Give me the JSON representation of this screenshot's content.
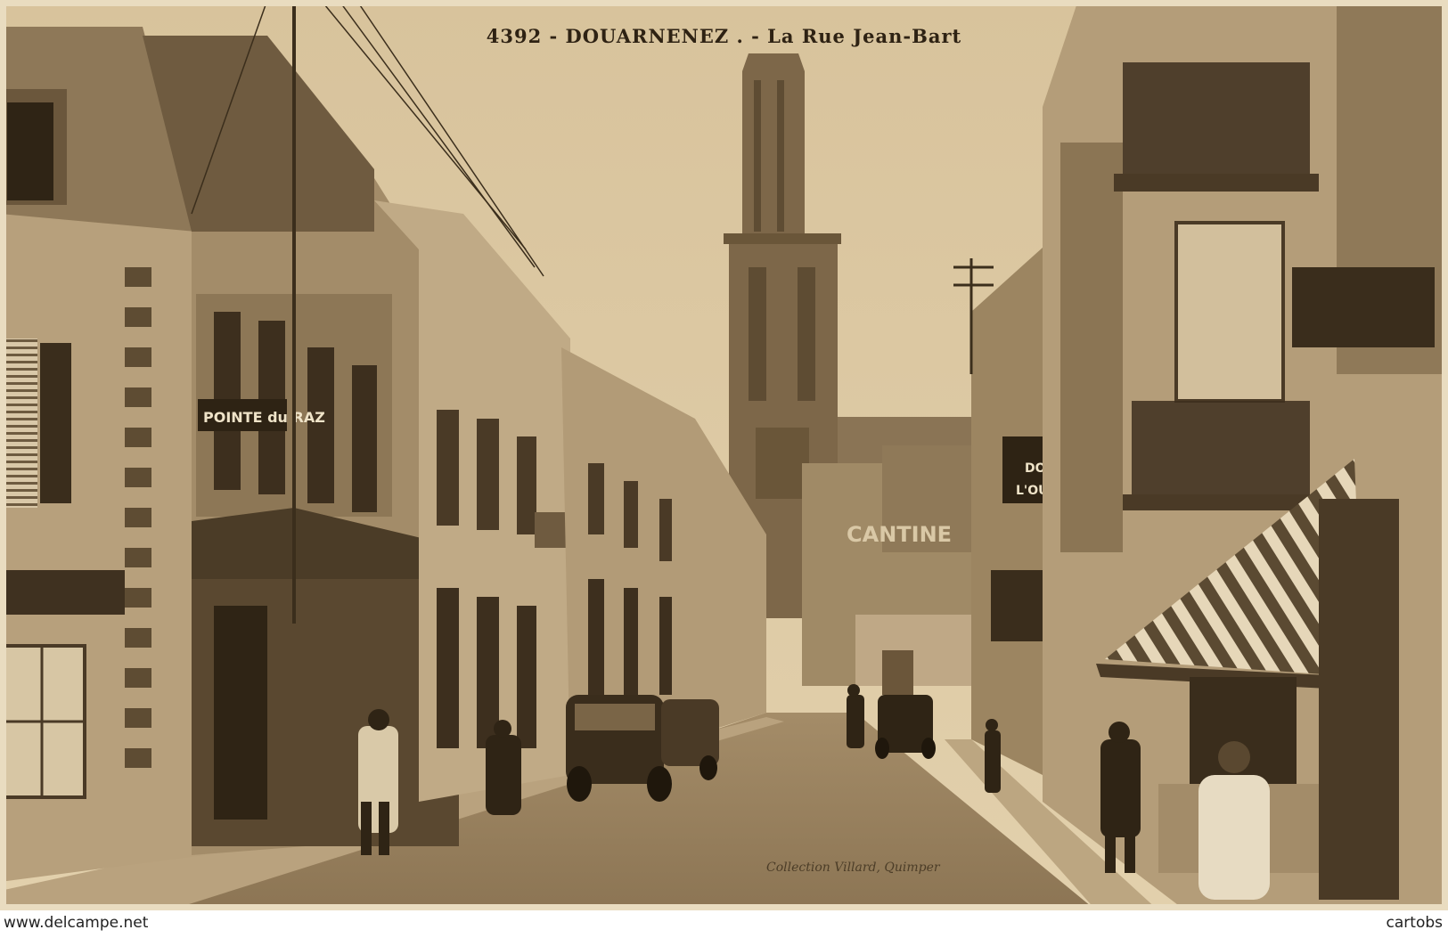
{
  "postcard": {
    "number": "4392",
    "town": "DOUARNENEZ",
    "street": "La Rue Jean-Bart",
    "publisher": "Collection Villard, Quimper"
  },
  "signs": {
    "hotel": "POINTE du RAZ",
    "docks_1": "DOCKS",
    "docks_2": "L'OUEST",
    "cantine": "CANTINE"
  },
  "footer": {
    "left_watermark": "www.delcampe.net",
    "right_watermark": "cartobs"
  },
  "colors": {
    "sky": "#dcc8a2",
    "ink": "#2e2213",
    "sepia_mid": "#9a8260",
    "sepia_dark": "#4a3a26"
  }
}
